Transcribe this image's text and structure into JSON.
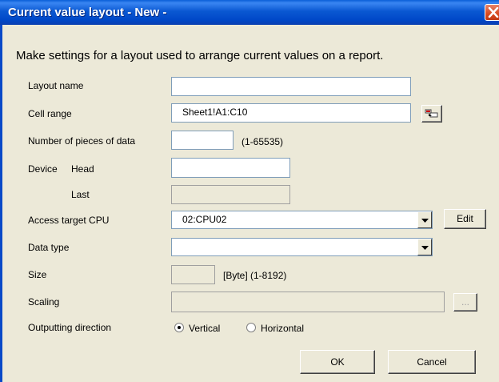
{
  "window": {
    "title": "Current value layout - New -"
  },
  "description": "Make settings for a layout used to arrange current values on a report.",
  "labels": {
    "layout_name": "Layout name",
    "cell_range": "Cell range",
    "num_pieces": "Number of pieces of data",
    "num_pieces_range": "(1-65535)",
    "device": "Device",
    "head": "Head",
    "last": "Last",
    "access_target_cpu": "Access target CPU",
    "data_type": "Data type",
    "size": "Size",
    "size_unit": "[Byte] (1-8192)",
    "scaling": "Scaling",
    "outputting_direction": "Outputting direction"
  },
  "fields": {
    "layout_name": "",
    "cell_range": "Sheet1!A1:C10",
    "num_pieces": "",
    "device_head": "",
    "device_last": "",
    "access_target_cpu": "02:CPU02",
    "data_type": "",
    "size": "",
    "scaling": ""
  },
  "radios": {
    "vertical": "Vertical",
    "horizontal": "Horizontal",
    "selected": "vertical"
  },
  "buttons": {
    "edit": "Edit",
    "browse": "...",
    "ok": "OK",
    "cancel": "Cancel"
  },
  "icons": {
    "close": "close-icon",
    "cell_range_picker": "range-select-icon",
    "dropdown": "dropdown-arrow-icon"
  }
}
